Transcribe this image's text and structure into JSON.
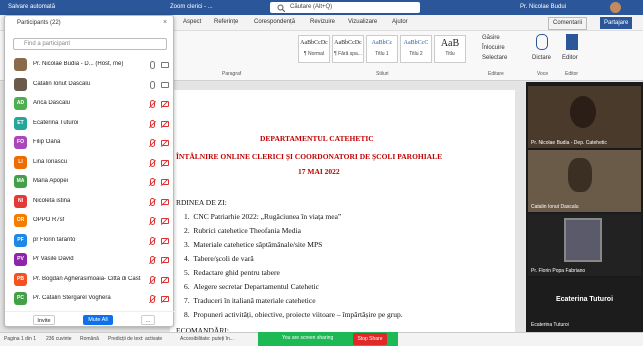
{
  "titlebar": {
    "autosave": "Salvare automată",
    "doc_title": "Zoom clerici - ...",
    "search": "Căutare (Alt+Q)",
    "user": "Pr. Nicolae Budui"
  },
  "tabs": [
    "Aspect",
    "Referințe",
    "Corespondență",
    "Revizuire",
    "Vizualizare",
    "Ajutor"
  ],
  "ribbon": {
    "comments": "Comentarii",
    "share": "Partajare",
    "styles": [
      {
        "preview": "AaBbCcDc",
        "name": "¶ Normal"
      },
      {
        "preview": "AaBbCcDc",
        "name": "¶ Fără spa..."
      },
      {
        "preview": "AaBbCc",
        "name": "Titlu 1"
      },
      {
        "preview": "AaBbCcC",
        "name": "Titlu 2"
      },
      {
        "preview": "AaB",
        "name": "Titlu"
      }
    ],
    "editing": [
      "Găsire",
      "Înlocuire",
      "Selectare"
    ],
    "dictate": "Dictare",
    "editor": "Editor",
    "group_labels": [
      "Paragraf",
      "Stiluri",
      "Editare",
      "Voce",
      "Editor"
    ]
  },
  "participants": {
    "header": "Participants (22)",
    "find_placeholder": "Find a participant",
    "list": [
      {
        "initials": "",
        "name": "Pr. Nicolae Budia - D... (Host, me)",
        "color": "#8a6a4a",
        "muted": false,
        "video": true
      },
      {
        "initials": "",
        "name": "Catalin Ionut Dascalu",
        "color": "#6a5a4a",
        "muted": false,
        "video": true
      },
      {
        "initials": "AD",
        "name": "Anca Dascalu",
        "color": "#4caf50",
        "muted": true,
        "video": false
      },
      {
        "initials": "ET",
        "name": "Ecaterina Tuturoi",
        "color": "#26a69a",
        "muted": true,
        "video": false
      },
      {
        "initials": "FO",
        "name": "Filip Oana",
        "color": "#ab47bc",
        "muted": true,
        "video": false
      },
      {
        "initials": "LI",
        "name": "Lina Ionascu",
        "color": "#ef6c00",
        "muted": true,
        "video": false
      },
      {
        "initials": "MA",
        "name": "Maria Apopei",
        "color": "#43a047",
        "muted": true,
        "video": false
      },
      {
        "initials": "NI",
        "name": "Nicoleta istina",
        "color": "#e53935",
        "muted": true,
        "video": false
      },
      {
        "initials": "OR",
        "name": "OPPO R7sf",
        "color": "#f57c00",
        "muted": true,
        "video": false
      },
      {
        "initials": "PF",
        "name": "pr Florin taranto",
        "color": "#1e88e5",
        "muted": true,
        "video": false
      },
      {
        "initials": "PV",
        "name": "Pr Vasile David",
        "color": "#8e24aa",
        "muted": true,
        "video": false
      },
      {
        "initials": "PB",
        "name": "Pr. Bogdan Agherasimoaia- Città di Cast...",
        "color": "#f4511e",
        "muted": true,
        "video": false
      },
      {
        "initials": "PC",
        "name": "Pr. Catalin Stergarel Voghera",
        "color": "#43a047",
        "muted": true,
        "video": false
      }
    ],
    "invite": "Invite",
    "mute_all": "Mute All",
    "more": "..."
  },
  "document": {
    "heading1": "DEPARTAMENTUL CATEHETIC",
    "heading2": "ÎNTÂLNIRE ONLINE CLERICI ȘI COORDONATORI DE ȘCOLI PAROHIALE",
    "heading3": "17 MAI 2022",
    "agenda_title": "RDINEA DE ZI:",
    "items": [
      "CNC Patriarhie 2022: „Rugăciunea în viața mea”",
      "Rubrici catehetice Theofania Media",
      "Materiale catehetice săptămânale/site MPS",
      "Tabere/școli de vară",
      "Redactare ghid pentru tabere",
      "Alegere secretar Departamentul Catehetic",
      "Traduceri în italiană materiale catehetice",
      "Propuneri activități, obiective, proiecte viitoare – împărtășire pe grup."
    ],
    "recommend": "ECOMANDĂRI:"
  },
  "statusbar": {
    "page": "Pagina 1 din 1",
    "words": "236 cuvinte",
    "lang": "Română",
    "predict": "Predicții de text: activate",
    "access": "Accesibilitate: puteți în...",
    "sharing": "You are screen sharing",
    "stop": "Stop Share"
  },
  "videos": [
    {
      "name": "Pr. Nicolae Budia - Dep. Catehetic"
    },
    {
      "name": "Catalin Ionut Dascalu"
    },
    {
      "name": "Pr. Florin Popa Fabriano"
    },
    {
      "name": "Ecaterina Tuturoi",
      "big_name": "Ecaterina Tuturoi"
    }
  ]
}
